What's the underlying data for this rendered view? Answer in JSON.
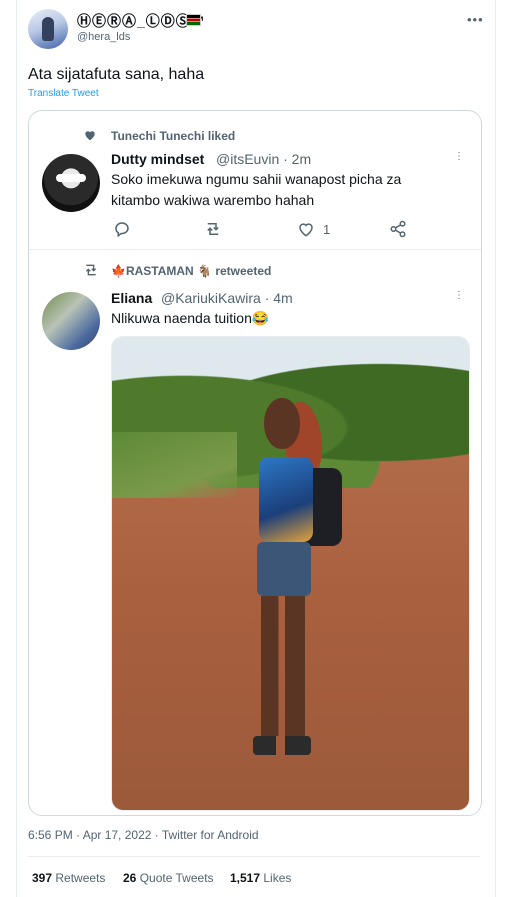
{
  "author": {
    "display_name": "ⒽⒺⓇⒶ_ⓁⒹⓈ™",
    "handle": "@hera_lds"
  },
  "tweet": {
    "text": "Ata sijatafuta sana, haha",
    "translate_label": "Translate Tweet",
    "meta": "6:56 PM · Apr 17, 2022 · Twitter for Android"
  },
  "quoted": [
    {
      "social_context": "Tunechi Tunechi liked",
      "name": "Dutty mindset",
      "handle": "@itsEuvin · 2m",
      "text_line1": "Soko imekuwa ngumu sahii wanapost picha za",
      "text_line2": "kitambo wakiwa warembo hahah",
      "like_count": "1"
    },
    {
      "social_context": "🍁RASTAMAN 🐐 retweeted",
      "name": "Eliana",
      "handle": "@KariukiKawira · 4m",
      "text": "Nlikuwa naenda tuition😂"
    }
  ],
  "stats": {
    "retweets_count": "397",
    "retweets_label": "Retweets",
    "quotes_count": "26",
    "quotes_label": "Quote Tweets",
    "likes_count": "1,517",
    "likes_label": "Likes"
  }
}
